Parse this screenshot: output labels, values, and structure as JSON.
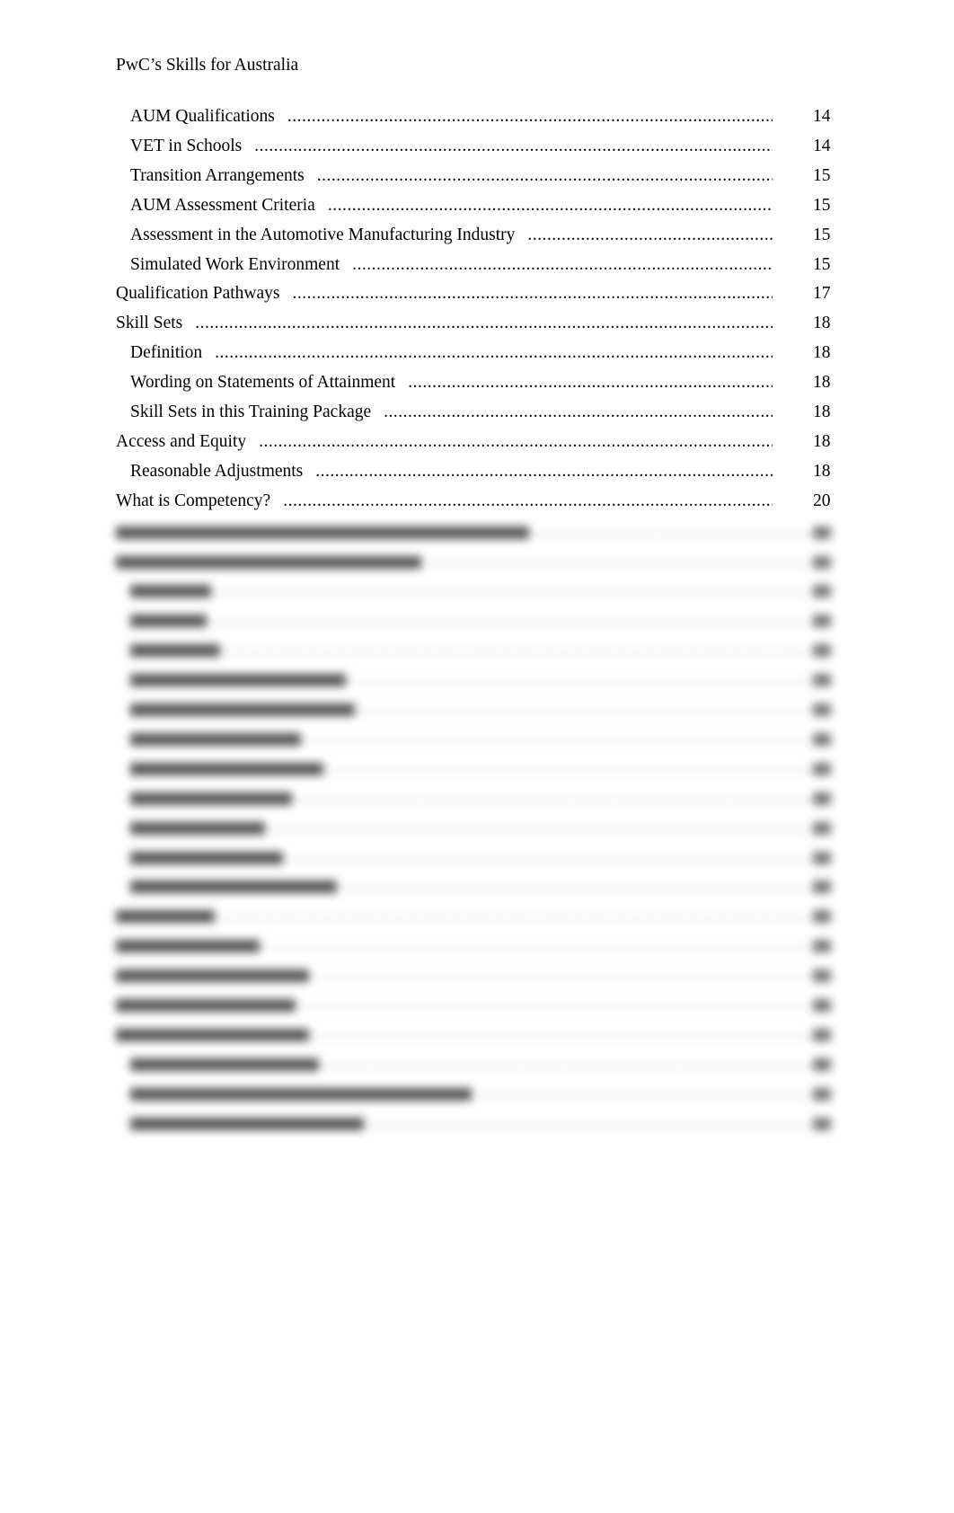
{
  "header": {
    "title": "PwC’s Skills for Australia"
  },
  "toc": {
    "visible_entries": [
      {
        "label": "AUM Qualifications",
        "level": 2,
        "page": "14"
      },
      {
        "label": "VET in Schools",
        "level": 2,
        "page": "14"
      },
      {
        "label": "Transition Arrangements",
        "level": 2,
        "page": "15"
      },
      {
        "label": "AUM Assessment Criteria",
        "level": 2,
        "page": "15"
      },
      {
        "label": "Assessment in the Automotive Manufacturing Industry",
        "level": 2,
        "page": "15"
      },
      {
        "label": "Simulated Work Environment",
        "level": 2,
        "page": "15"
      },
      {
        "label": "Qualification Pathways",
        "level": 1,
        "page": "17"
      },
      {
        "label": "Skill Sets",
        "level": 1,
        "page": "18"
      },
      {
        "label": "Definition",
        "level": 2,
        "page": "18"
      },
      {
        "label": "Wording on Statements of Attainment",
        "level": 2,
        "page": "18"
      },
      {
        "label": "Skill Sets in this Training Package",
        "level": 2,
        "page": "18"
      },
      {
        "label": "Access and Equity",
        "level": 1,
        "page": "18"
      },
      {
        "label": "Reasonable Adjustments",
        "level": 2,
        "page": "18"
      },
      {
        "label": "What is Competency?",
        "level": 1,
        "page": "20"
      }
    ],
    "blurred_entry_levels": [
      1,
      1,
      2,
      2,
      2,
      2,
      2,
      2,
      2,
      2,
      2,
      2,
      2,
      1,
      1,
      1,
      1,
      1,
      2,
      2,
      2
    ],
    "dot_leader": "...................................................................................................."
  }
}
